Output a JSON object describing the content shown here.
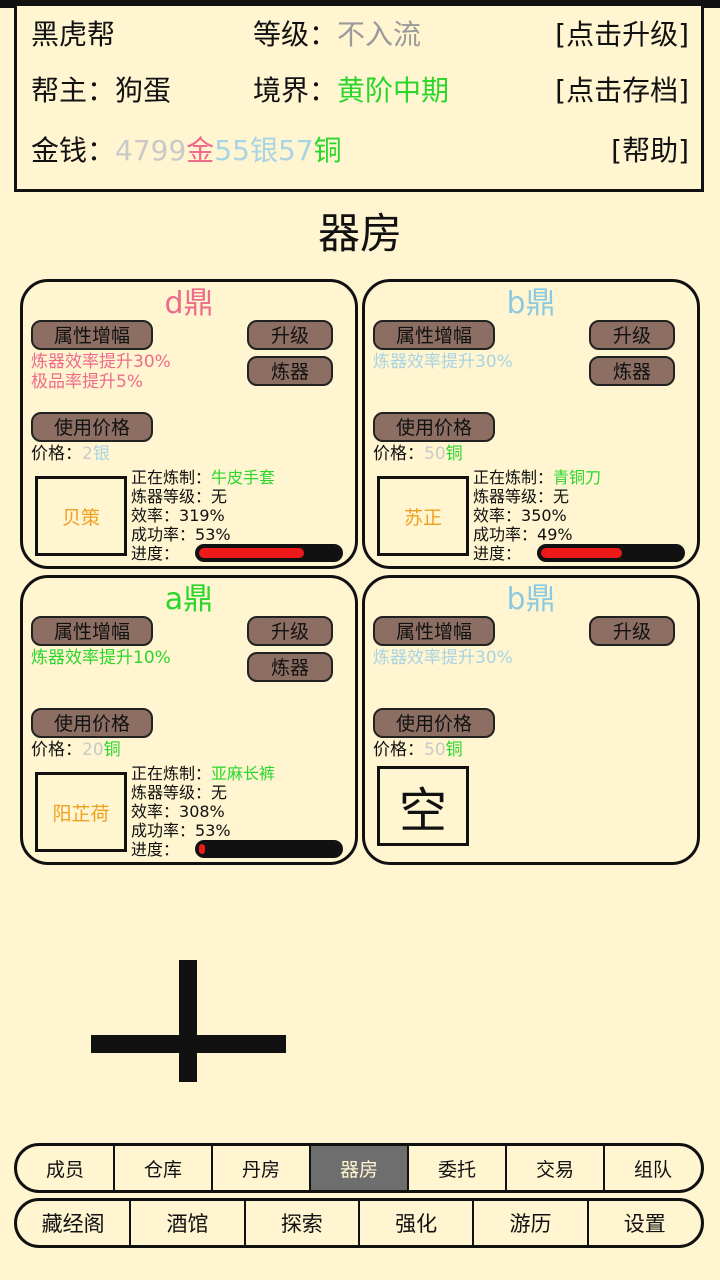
{
  "header": {
    "gang_name": "黑虎帮",
    "level_label": "等级：",
    "level_value": "不入流",
    "upgrade_link": "[点击升级]",
    "leader_label": "帮主：",
    "leader_name": "狗蛋",
    "realm_label": "境界：",
    "realm_value": "黄阶中期",
    "save_link": "[点击存档]",
    "money_label": "金钱：",
    "gold_amount": "4799",
    "gold_unit": "金",
    "silver_amount": "55",
    "silver_unit": "银",
    "copper_amount": "57",
    "copper_unit": "铜",
    "help_link": "[帮助]"
  },
  "page_title": "器房",
  "cards": [
    {
      "title": "d鼎",
      "title_color": "#ee6b8b",
      "attr_button": "属性增幅",
      "upgrade_button": "升级",
      "forge_button": "炼器",
      "effects": [
        "炼器效率提升30%",
        "极品率提升5%"
      ],
      "effect_color": "#ee6b8b",
      "price_button": "使用价格",
      "price_label": "价格：",
      "price_amount": "2",
      "price_unit": "银",
      "price_unit_color": "#a8d4e4",
      "worker": "贝策",
      "making_label": "正在炼制：",
      "making_item": "牛皮手套",
      "forge_level_label": "炼器等级：",
      "forge_level": "无",
      "efficiency_label": "效率：",
      "efficiency": "319%",
      "success_label": "成功率：",
      "success": "53%",
      "progress_label": "进度：",
      "progress": 0.75
    },
    {
      "title": "b鼎",
      "title_color": "#8ec9e2",
      "attr_button": "属性增幅",
      "upgrade_button": "升级",
      "forge_button": "炼器",
      "effects": [
        "炼器效率提升30%"
      ],
      "effect_color": "#a8d4e4",
      "price_button": "使用价格",
      "price_label": "价格：",
      "price_amount": "50",
      "price_unit": "铜",
      "price_unit_color": "#2ad62a",
      "worker": "苏正",
      "making_label": "正在炼制：",
      "making_item": "青铜刀",
      "forge_level_label": "炼器等级：",
      "forge_level": "无",
      "efficiency_label": "效率：",
      "efficiency": "350%",
      "success_label": "成功率：",
      "success": "49%",
      "progress_label": "进度：",
      "progress": 0.58
    },
    {
      "title": "a鼎",
      "title_color": "#2ad62a",
      "attr_button": "属性增幅",
      "upgrade_button": "升级",
      "forge_button": "炼器",
      "effects": [
        "炼器效率提升10%"
      ],
      "effect_color": "#2ad62a",
      "price_button": "使用价格",
      "price_label": "价格：",
      "price_amount": "20",
      "price_unit": "铜",
      "price_unit_color": "#2ad62a",
      "worker": "阳芷荷",
      "making_label": "正在炼制：",
      "making_item": "亚麻长裤",
      "forge_level_label": "炼器等级：",
      "forge_level": "无",
      "efficiency_label": "效率：",
      "efficiency": "308%",
      "success_label": "成功率：",
      "success": "53%",
      "progress_label": "进度：",
      "progress": 0.03
    },
    {
      "title": "b鼎",
      "title_color": "#8ec9e2",
      "attr_button": "属性增幅",
      "upgrade_button": "升级",
      "effects": [
        "炼器效率提升30%"
      ],
      "effect_color": "#a8d4e4",
      "price_button": "使用价格",
      "price_label": "价格：",
      "price_amount": "50",
      "price_unit": "铜",
      "price_unit_color": "#2ad62a",
      "worker": "空"
    }
  ],
  "tabs_row1": [
    "成员",
    "仓库",
    "丹房",
    "器房",
    "委托",
    "交易",
    "组队"
  ],
  "active_tab": "器房",
  "tabs_row2": [
    "藏经阁",
    "酒馆",
    "探索",
    "强化",
    "游历",
    "设置"
  ]
}
